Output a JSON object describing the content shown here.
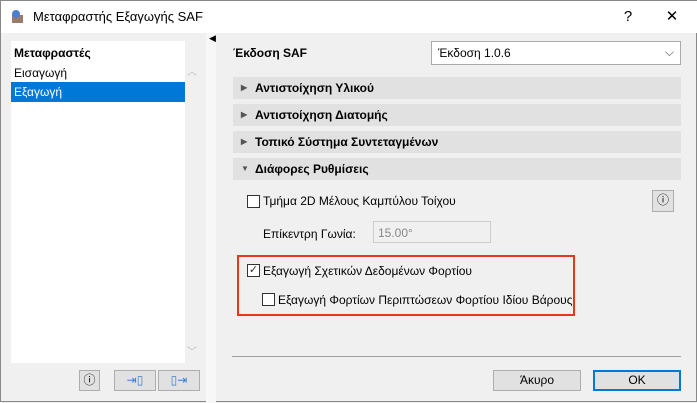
{
  "window": {
    "title": "Μεταφραστής Εξαγωγής SAF",
    "help": "?",
    "close": "✕"
  },
  "sidebar": {
    "header": "Μεταφραστές",
    "items": [
      {
        "label": "Εισαγωγή"
      },
      {
        "label": "Εξαγωγή",
        "selected": true
      }
    ]
  },
  "main": {
    "version_label": "Έκδοση SAF",
    "version_value": "Έκδοση 1.0.6",
    "sections": [
      {
        "label": "Αντιστοίχηση Υλικού"
      },
      {
        "label": "Αντιστοίχηση Διατομής"
      },
      {
        "label": "Τοπικό Σύστημα Συντεταγμένων"
      },
      {
        "label": "Διάφορες Ρυθμίσεις",
        "expanded": true
      }
    ],
    "curved_wall": {
      "label": "Τμήμα 2D Μέλους Καμπύλου Τοίχου",
      "checked": false
    },
    "angle": {
      "label": "Επίκεντρη Γωνία:",
      "value": "15.00°"
    },
    "export_load": {
      "label": "Εξαγωγή Σχετικών Δεδομένων Φορτίου",
      "checked": true
    },
    "export_selfweight": {
      "label": "Εξαγωγή Φορτίων Περιπτώσεων Φορτίου Ιδίου Βάρους",
      "checked": false
    }
  },
  "footer": {
    "cancel": "Άκυρο",
    "ok": "OK"
  },
  "colors": {
    "accent": "#0078d7",
    "highlight": "#e8361e"
  }
}
